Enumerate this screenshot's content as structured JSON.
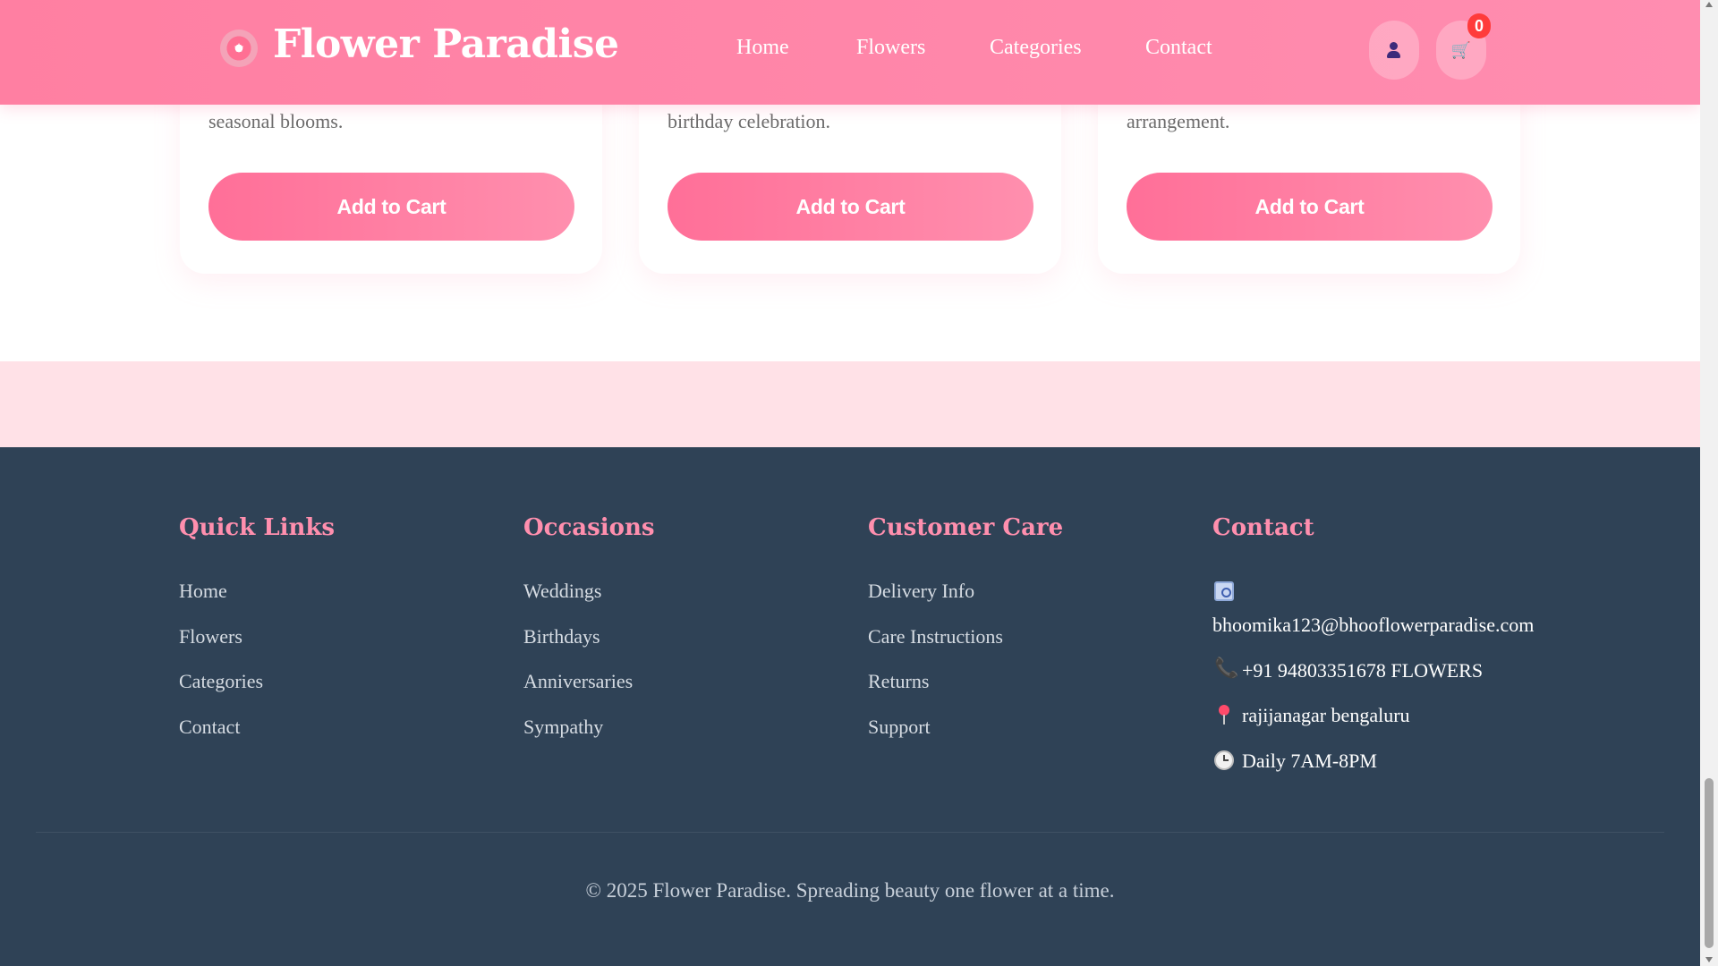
{
  "header": {
    "brand": "Flower Paradise",
    "logo_icon": "flower-icon",
    "nav": [
      "Home",
      "Flowers",
      "Categories",
      "Contact"
    ],
    "account_icon": "user-icon",
    "cart_icon": "cart-icon",
    "cart_count": "0"
  },
  "products": [
    {
      "description": "seasonal blooms.",
      "button": "Add to Cart"
    },
    {
      "description": "birthday celebration.",
      "button": "Add to Cart"
    },
    {
      "description": "arrangement.",
      "button": "Add to Cart"
    }
  ],
  "footer": {
    "columns": [
      {
        "title": "Quick Links",
        "links": [
          "Home",
          "Flowers",
          "Categories",
          "Contact"
        ]
      },
      {
        "title": "Occasions",
        "links": [
          "Weddings",
          "Birthdays",
          "Anniversaries",
          "Sympathy"
        ]
      },
      {
        "title": "Customer Care",
        "links": [
          "Delivery Info",
          "Care Instructions",
          "Returns",
          "Support"
        ]
      }
    ],
    "contact": {
      "title": "Contact",
      "email": "bhoomika123@bhooflowerparadise.com",
      "phone": "+91 94803351678 FLOWERS",
      "address": "rajijanagar bengaluru",
      "hours": "Daily 7AM-8PM"
    },
    "copyright": "© 2025 Flower Paradise. Spreading beauty one flower at a time."
  },
  "colors": {
    "header_bg": "#ff85a6",
    "accent_pink": "#ff8fae",
    "footer_bg": "#2f4256",
    "band_pink": "#ffe1e7",
    "badge_red": "#ff3b3b"
  }
}
